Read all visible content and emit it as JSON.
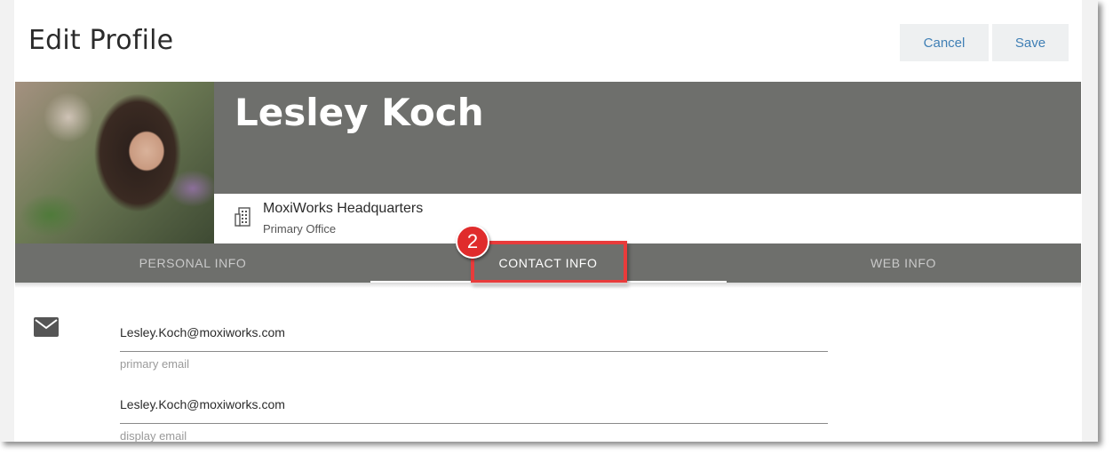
{
  "header": {
    "title": "Edit Profile",
    "cancel_label": "Cancel",
    "save_label": "Save"
  },
  "profile": {
    "name": "Lesley Koch",
    "office_name": "MoxiWorks Headquarters",
    "office_role": "Primary Office"
  },
  "tabs": [
    {
      "label": "PERSONAL INFO"
    },
    {
      "label": "CONTACT INFO"
    },
    {
      "label": "WEB INFO"
    }
  ],
  "callout": {
    "step": "2"
  },
  "contact": {
    "fields": [
      {
        "value": "Lesley.Koch@moxiworks.com",
        "label": "primary email"
      },
      {
        "value": "Lesley.Koch@moxiworks.com",
        "label": "display email"
      }
    ]
  },
  "colors": {
    "banner": "#6e6f6c",
    "button_text": "#3f7fb5",
    "button_bg": "#eef0f1",
    "callout_red": "#e83b3b"
  },
  "icons": [
    "office-building-icon",
    "envelope-icon"
  ]
}
